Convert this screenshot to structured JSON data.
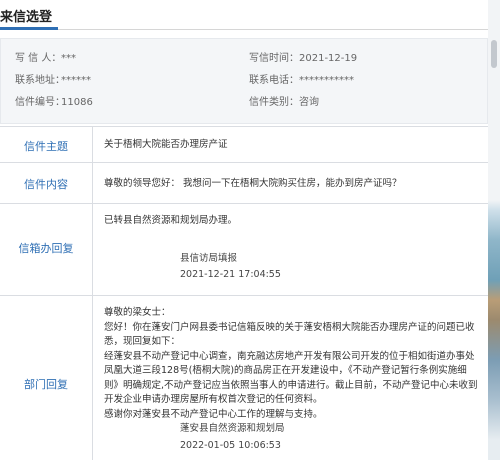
{
  "header": {
    "title": "来信选登"
  },
  "info": {
    "writer_label": "写 信 人：",
    "writer_value": "***",
    "date_label": "写信时间：",
    "date_value": "2021-12-19",
    "address_label": "联系地址：",
    "address_value": "******",
    "phone_label": "联系电话：",
    "phone_value": "***********",
    "number_label": "信件编号：",
    "number_value": "11086",
    "category_label": "信件类别：",
    "category_value": "咨询"
  },
  "table": {
    "subject_label": "信件主题",
    "subject_value": "关于梧桐大院能否办理房产证",
    "content_label": "信件内容",
    "content_value": "尊敬的领导您好：  我想问一下在梧桐大院购买住房，能办到房产证吗？",
    "handling_label": "信箱办回复",
    "handling_text": "已转县自然资源和规划局办理。",
    "handling_sig_org": "县信访局填报",
    "handling_sig_date": "2021-12-21 17:04:55",
    "dept_label": "部门回复",
    "dept_greeting": "尊敬的梁女士：",
    "dept_p1": "  您好！你在蓬安门户网县委书记信箱反映的关于蓬安梧桐大院能否办理房产证的问题已收悉，现回复如下：",
    "dept_p2": "  经蓬安县不动产登记中心调查，南充融达房地产开发有限公司开发的位于相如街道办事处凤凰大道三段128号(梧桐大院)的商品房正在开发建设中，《不动产登记暂行条例实施细则》明确规定,不动产登记应当依照当事人的申请进行。截止目前，不动产登记中心未收到开发企业申请办理房屋所有权首次登记的任何资料。",
    "dept_p3": "  感谢你对蓬安县不动产登记中心工作的理解与支持。",
    "dept_sig_org": "蓬安县自然资源和规划局",
    "dept_sig_date": "2022-01-05 10:06:53"
  }
}
